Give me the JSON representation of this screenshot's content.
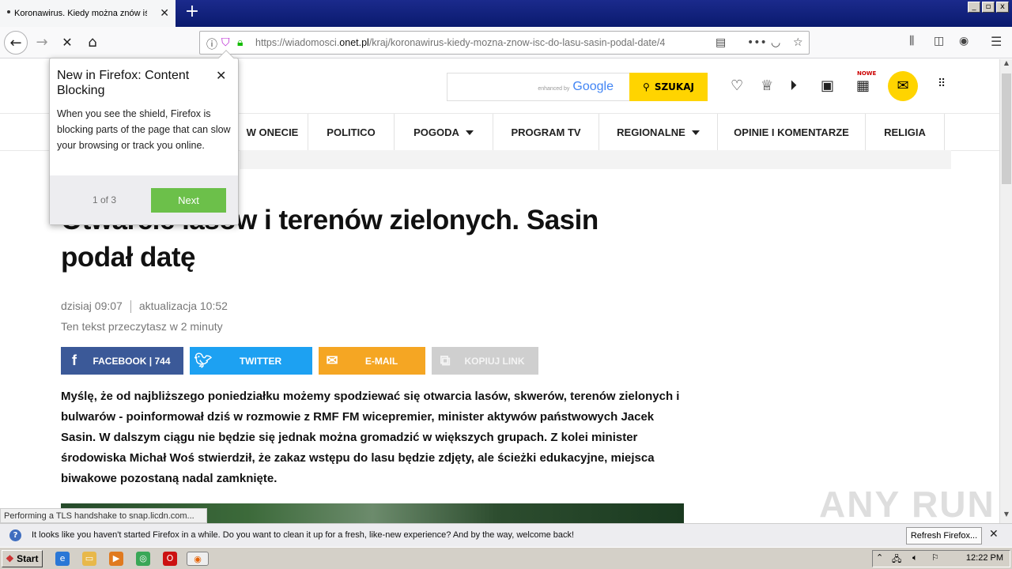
{
  "browser": {
    "tab_title": "Koronawirus. Kiedy można znów iść",
    "tab_close": "✕",
    "new_tab": "+",
    "url_prefix": "https://wiadomosci.",
    "url_domain": "onet.pl",
    "url_path": "/kraj/koronawirus-kiedy-mozna-znow-isc-do-lasu-sasin-podal-date/4"
  },
  "site": {
    "search_placeholder": "",
    "google_enhanced": "enhanced by",
    "google_word": "Google",
    "search_button": "SZUKAJ",
    "nowe_badge": "NOWE"
  },
  "menu": {
    "items": [
      {
        "label": "W ONECIE",
        "caret": false
      },
      {
        "label": "POLITICO",
        "caret": false
      },
      {
        "label": "POGODA",
        "caret": true
      },
      {
        "label": "PROGRAM TV",
        "caret": false
      },
      {
        "label": "REGIONALNE",
        "caret": true
      },
      {
        "label": "OPINIE I KOMENTARZE",
        "caret": false
      },
      {
        "label": "RELIGIA",
        "caret": false
      }
    ]
  },
  "article": {
    "headline": "Otwarcie lasów i terenów zielonych. Sasin podał datę",
    "published": "dzisiaj 09:07",
    "updated": "aktualizacja 10:52",
    "read_time": "Ten tekst przeczytasz w 2 minuty",
    "lead": "Myślę, że od najbliższego poniedziałku możemy spodziewać się otwarcia lasów, skwerów, terenów zielonych i bulwarów - poinformował dziś w rozmowie z RMF FM wicepremier, minister aktywów państwowych Jacek Sasin. W dalszym ciągu nie będzie się jednak można gromadzić w większych grupach. Z kolei minister środowiska Michał Woś stwierdził, że zakaz wstępu do lasu będzie zdjęty, ale ścieżki edukacyjne, miejsca biwakowe pozostaną nadal zamknięte."
  },
  "share": {
    "facebook": "FACEBOOK | 744",
    "twitter": "TWITTER",
    "email": "E-MAIL",
    "copy": "KOPIUJ LINK",
    "colors": {
      "facebook": "#3b5998",
      "twitter": "#1da1f2",
      "email": "#f5a623",
      "copy": "#cfcfcf"
    }
  },
  "popup": {
    "title": "New in Firefox: Content Blocking",
    "body": "When you see the shield, Firefox is blocking parts of the page that can slow your browsing or track you online.",
    "step": "1 of 3",
    "next": "Next",
    "close": "✕"
  },
  "status_text": "Performing a TLS handshake to snap.licdn.com...",
  "notification": {
    "text": "It looks like you haven't started Firefox in a while. Do you want to clean it up for a fresh, like-new experience? And by the way, welcome back!",
    "button": "Refresh Firefox...",
    "close": "✕"
  },
  "watermark": "ANY RUN",
  "taskbar": {
    "start": "Start",
    "clock": "12:22 PM"
  }
}
